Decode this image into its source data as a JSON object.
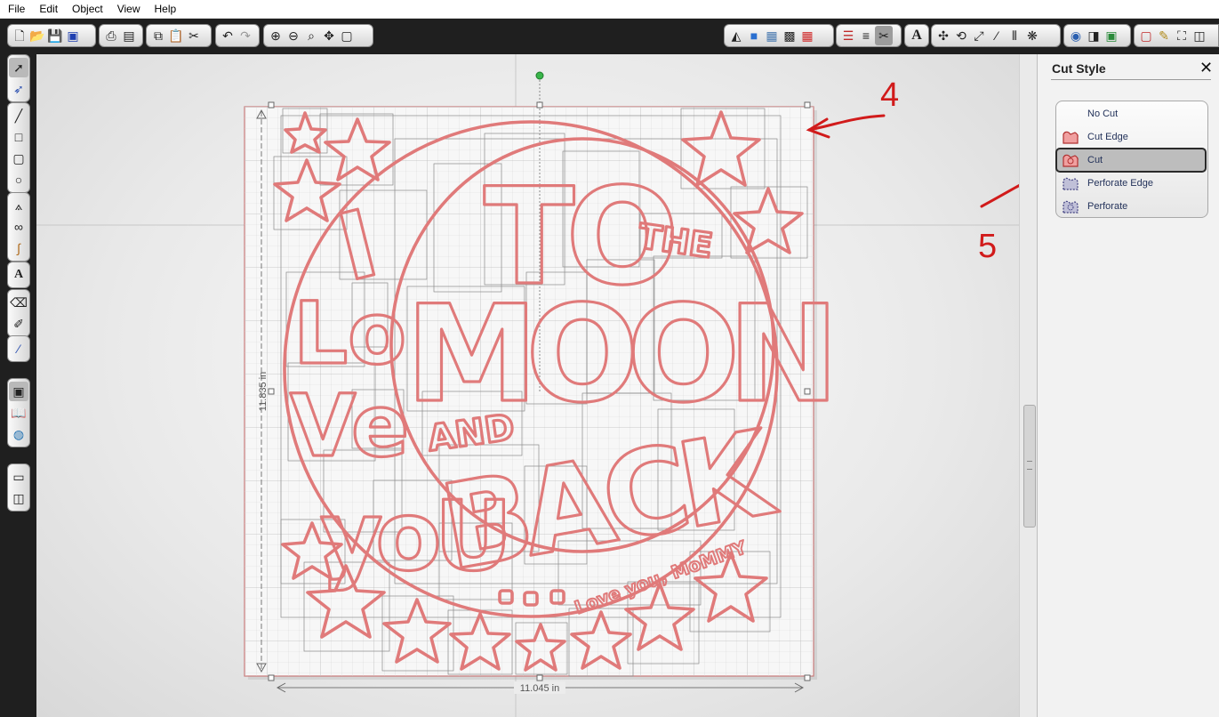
{
  "menu": [
    "File",
    "Edit",
    "Object",
    "View",
    "Help"
  ],
  "toolbar": {
    "file_icons": [
      "new-file-icon",
      "open-folder-icon",
      "save-icon",
      "save-3d-icon"
    ],
    "print_icons": [
      "print-icon",
      "print-cut-icon"
    ],
    "clipboard_icons": [
      "copy-icon",
      "paste-icon",
      "cut-icon"
    ],
    "history_icons": [
      "undo-icon",
      "redo-icon"
    ],
    "zoom_icons": [
      "zoom-in-icon",
      "zoom-out-icon",
      "zoom-select-icon",
      "pan-icon",
      "fit-page-icon"
    ],
    "style_icons": [
      "fill-icon",
      "color-icon",
      "pattern-icon",
      "texture-icon",
      "grid-fill-icon"
    ],
    "line_icons": [
      "line-color-icon",
      "line-style-icon",
      "cut-style-icon"
    ],
    "text_icons": [
      "text-style-icon"
    ],
    "transform_icons": [
      "move-icon",
      "rotate-icon",
      "scale-icon",
      "shear-icon",
      "mirror-icon",
      "replicate-icon"
    ],
    "misc_icons": [
      "modify-icon",
      "offset-icon",
      "trace-icon"
    ],
    "window_icons": [
      "page-setup-icon",
      "sketch-icon",
      "fullscreen-icon",
      "split-icon"
    ],
    "text_tool_label": "A"
  },
  "left_tools": {
    "group1": [
      "select-icon",
      "point-edit-icon"
    ],
    "group2": [
      "line-tool-icon",
      "rectangle-tool-icon",
      "rounded-rect-tool-icon",
      "ellipse-tool-icon"
    ],
    "group3": [
      "polygon-tool-icon",
      "curve-tool-icon",
      "freehand-tool-icon"
    ],
    "group4": [
      "text-tool-icon"
    ],
    "group5": [
      "eraser-icon",
      "knife-icon"
    ],
    "group6": [
      "eyedropper-icon"
    ],
    "group7": [
      "design-page-icon",
      "library-icon",
      "store-icon"
    ],
    "group8": [
      "send-panel-icon",
      "layout-panel-icon"
    ]
  },
  "canvas": {
    "width_label": "11.045 in",
    "height_label": "11.835 in",
    "artwork_text": {
      "i": "I",
      "to": "TO",
      "the": "THE",
      "lo": "Lo",
      "moon": "MOON",
      "ve": "Ve",
      "and": "AND",
      "you": "yoU",
      "back": "BACK",
      "love_you": "Love you, MoMMY"
    },
    "stroke_color": "#e07a7a",
    "page_border_color": "#c97b7b"
  },
  "annotations": {
    "number_4": "4",
    "number_5": "5",
    "arrow_color": "#d11b1b"
  },
  "panel": {
    "title": "Cut Style",
    "close_label": "✕",
    "options": [
      {
        "label": "No Cut",
        "icon": "none",
        "selected": false
      },
      {
        "label": "Cut Edge",
        "icon": "cut-edge-icon",
        "selected": false
      },
      {
        "label": "Cut",
        "icon": "cut-icon",
        "selected": true
      },
      {
        "label": "Perforate Edge",
        "icon": "perforate-edge-icon",
        "selected": false
      },
      {
        "label": "Perforate",
        "icon": "perforate-icon",
        "selected": false
      }
    ]
  }
}
